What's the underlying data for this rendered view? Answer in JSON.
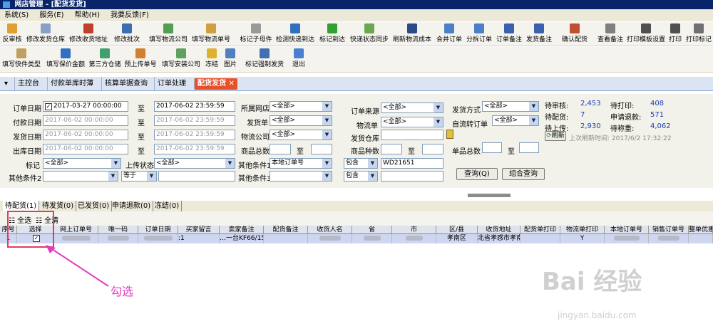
{
  "title": "网店管理 - [配货发货]",
  "menu": [
    "系统(S)",
    "服务(E)",
    "帮助(H)",
    "我要反馈(F)"
  ],
  "toolbar1": [
    "反审核",
    "修改发货仓库",
    "修改收货地址",
    "修改批次",
    "填写物流公司",
    "填写物流单号",
    "标记子母件",
    "检测快递到达",
    "标记到达",
    "快递状态同步",
    "刷新物流成本",
    "合并订单",
    "分拆订单",
    "订单备注",
    "发货备注",
    "确认配货",
    "查看备注",
    "打印模板设置",
    "打印",
    "打印标记"
  ],
  "toolbar2": [
    "填写快件类型",
    "填写保价金额",
    "第三方仓储",
    "预上传单号",
    "填写安装公司",
    "冻结",
    "图片",
    "标记强制发货",
    "退出"
  ],
  "nav": [
    "主控台",
    "付款单库时薄",
    "核算单据查询",
    "订单处理",
    "配货发货"
  ],
  "filter": {
    "order_date_label": "订单日期",
    "order_date_from": "2017-03-27 00:00:00",
    "to": "至",
    "order_date_to": "2017-06-02 23:59:59",
    "pay_date_label": "付款日期",
    "pay_date_from": "2017-06-02 00:00:00",
    "pay_date_to": "2017-06-02 23:59:59",
    "ship_date_label": "发货日期",
    "ship_date_from": "2017-06-02 00:00:00",
    "ship_date_to": "2017-06-02 23:59:59",
    "out_date_label": "出库日期",
    "out_date_from": "2017-06-02 00:00:00",
    "out_date_to": "2017-06-02 23:59:59",
    "mark_label": "标记",
    "mark_value": "<全部>",
    "upload_label": "上传状态",
    "upload_value": "<全部>",
    "other2_label": "其他条件2",
    "other2_op": "等于",
    "shop_label": "所属网店",
    "shop_value": "<全部>",
    "ship_label": "发货单",
    "ship_value": "<全部>",
    "logistics_label": "物流公司",
    "logistics_value": "<全部>",
    "goods_total_label": "商品总数",
    "to2": "至",
    "other1_label": "其他条件1",
    "other1_value": "本地订单号",
    "other3_label": "其他条件3",
    "source_label": "订单来源",
    "source_value": "<全部>",
    "logno_label": "物流单",
    "logno_value": "<全部>",
    "warehouse_label": "发货仓库",
    "kinds_label": "商品种数",
    "contains": "包含",
    "contains_value": "WD21651",
    "contains2": "包含",
    "ship_method_label": "发货方式",
    "ship_method_value": "<全部>",
    "auto_label": "自流转订单",
    "auto_value": "<全部>",
    "goods_sum_label": "单品总数",
    "query_btn": "查询(Q)",
    "combo_btn": "组合查询"
  },
  "stats": {
    "pending_review_label": "待审核:",
    "pending_review": "2,453",
    "pending_print_label": "待打印:",
    "pending_print": "408",
    "pending_alloc_label": "待配货:",
    "pending_alloc": "7",
    "refund_label": "申请退款:",
    "refund": "571",
    "pending_upload_label": "待上传:",
    "pending_upload": "2,930",
    "weight_label": "待称重:",
    "weight": "4,062",
    "refresh_label": "刷新",
    "last_refresh": "上次刷新时间: 2017/6/2 17:32:22"
  },
  "tabs": [
    "待配货(1)",
    "待发货(0)",
    "已发货(0)",
    "申请退款(0)",
    "冻结(0)"
  ],
  "subbar": {
    "select_all": "全选",
    "clear": "全清"
  },
  "grid": {
    "headers": [
      "序号",
      "选择",
      "网上订单号",
      "唯一码",
      "订单日期",
      "买家留言",
      "卖家备注",
      "配货备注",
      "收货人名",
      "省",
      "市",
      "区/县",
      "收货地址",
      "配货单打印",
      "物流单打印",
      "本地订单号",
      "销售订单号",
      "整单优惠"
    ],
    "row": {
      "no": "1",
      "seller_note": "…一台KF66/150:",
      "district": "孝南区",
      "address": "北省孝感市孝南",
      "logistics_print": "Y",
      "buyer_msg": ":1"
    }
  },
  "annotation": "勾选",
  "watermark": "Bai 经验",
  "watermark_sub": "jingyan.baidu.com"
}
